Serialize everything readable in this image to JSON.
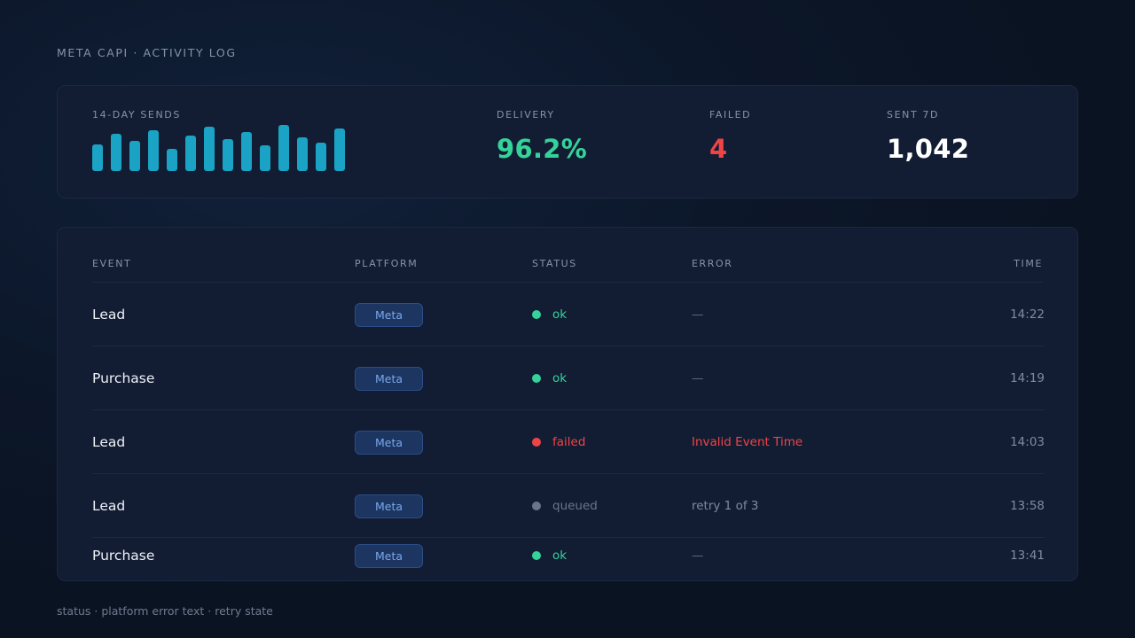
{
  "page": {
    "label": "META CAPI · ACTIVITY LOG"
  },
  "stats": {
    "sparkline": {
      "label": "14-DAY SENDS",
      "values": [
        29,
        41,
        33,
        45,
        25,
        39,
        49,
        35,
        43,
        28,
        51,
        37,
        31,
        47
      ]
    },
    "delivery": {
      "label": "DELIVERY",
      "value": "96.2%",
      "color": "#34d399"
    },
    "failed": {
      "label": "FAILED",
      "value": "4",
      "color": "#ef4444"
    },
    "sent": {
      "label": "SENT 7D",
      "value": "1,042",
      "color": "#ffffff"
    }
  },
  "table": {
    "headers": {
      "event": "EVENT",
      "platform": "PLATFORM",
      "status": "STATUS",
      "error": "ERROR",
      "time": "TIME"
    },
    "rows": [
      {
        "event": "Lead",
        "platform": "Meta",
        "status": "ok",
        "error": "—",
        "time": "14:22"
      },
      {
        "event": "Purchase",
        "platform": "Meta",
        "status": "ok",
        "error": "—",
        "time": "14:19"
      },
      {
        "event": "Lead",
        "platform": "Meta",
        "status": "failed",
        "error": "Invalid Event Time",
        "time": "14:03"
      },
      {
        "event": "Lead",
        "platform": "Meta",
        "status": "queued",
        "error": "retry 1 of 3",
        "time": "13:58"
      },
      {
        "event": "Purchase",
        "platform": "Meta",
        "status": "ok",
        "error": "—",
        "time": "13:41"
      }
    ]
  },
  "status_colors": {
    "ok": "#34d399",
    "failed": "#ef4444",
    "queued": "#6b7587"
  },
  "error_colors": {
    "ok": "#5d6a80",
    "failed": "#ef4444",
    "queued": "#7f8ba0"
  },
  "footer": {
    "text": "status · platform error text · retry state"
  }
}
